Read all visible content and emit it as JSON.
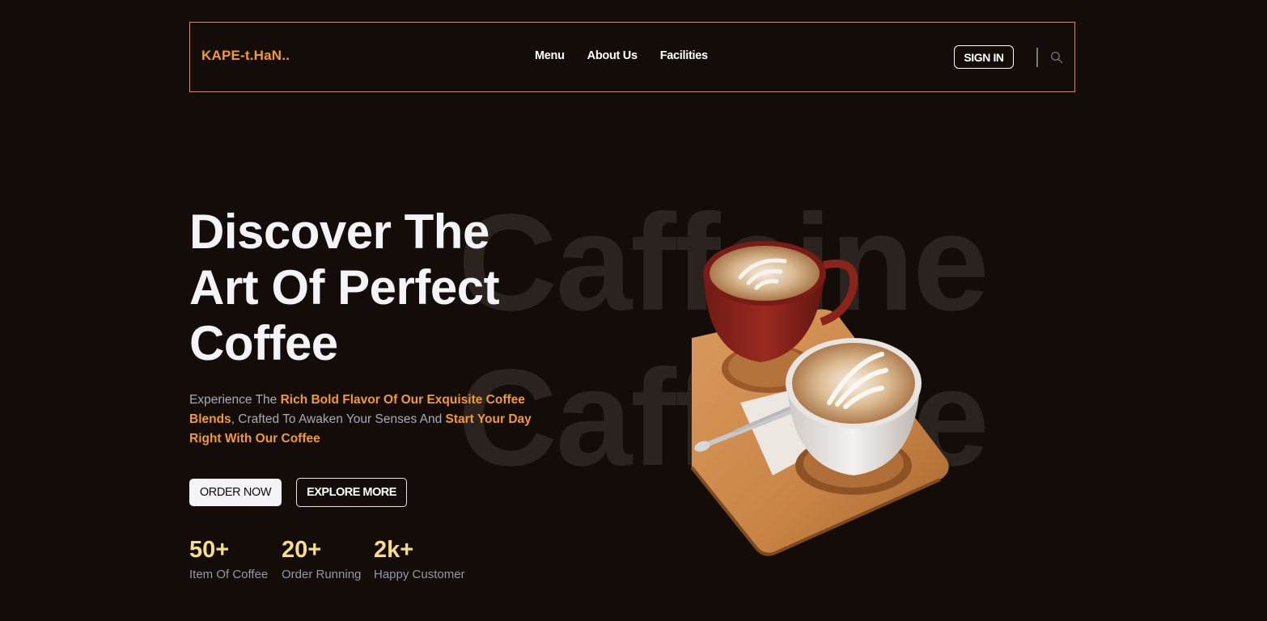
{
  "nav": {
    "brand": "KAPE-t.HaN..",
    "links": [
      "Menu",
      "About Us",
      "Facilities"
    ],
    "signin_label": "SIGN IN",
    "search_icon": "search-icon"
  },
  "watermark": {
    "line1": "Caffeine",
    "line2": "Caffeine"
  },
  "hero": {
    "title_line1": "Discover The",
    "title_line2": "Art Of Perfect",
    "title_line3": "Coffee",
    "desc_part1": "Experience The ",
    "desc_highlight1": "Rich Bold Flavor Of Our Exquisite Coffee Blends",
    "desc_part2": ", Crafted To Awaken Your Senses And ",
    "desc_highlight2": "Start Your Day Right With Our Coffee",
    "order_label": "ORDER NOW",
    "explore_label": "EXPLORE MORE"
  },
  "stats": [
    {
      "value": "50+",
      "label": "Item Of Coffee"
    },
    {
      "value": "20+",
      "label": "Order Running"
    },
    {
      "value": "2k+",
      "label": "Happy Customer"
    }
  ],
  "colors": {
    "background": "#140c08",
    "accent": "#f29a2e",
    "stat": "#f7dd8a"
  }
}
